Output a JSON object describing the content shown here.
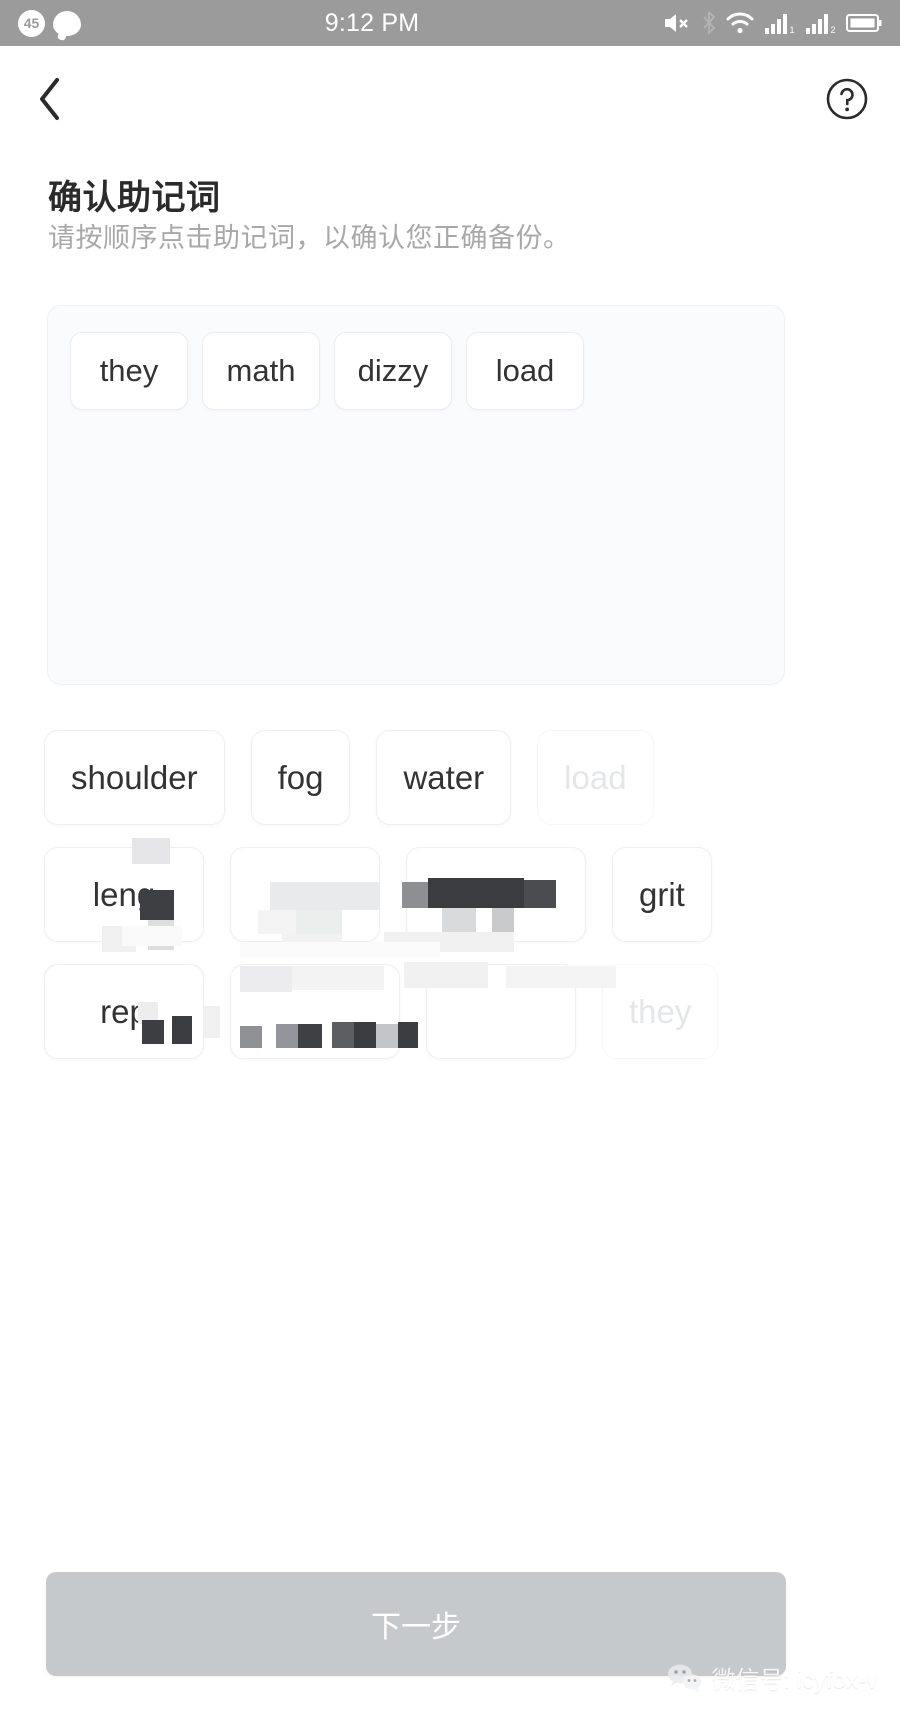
{
  "status_bar": {
    "notification_count": "45",
    "time": "9:12 PM",
    "icons": [
      "message-bubble-icon",
      "volume-mute-icon",
      "bluetooth-icon",
      "wifi-icon",
      "signal-sim1-icon",
      "signal-sim2-icon",
      "battery-icon"
    ]
  },
  "nav": {
    "back_icon": "chevron-left-icon",
    "help_icon": "help-circle-icon"
  },
  "header": {
    "title": "确认助记词",
    "subtitle": "请按顺序点击助记词，以确认您正确备份。"
  },
  "selected": {
    "words": [
      "they",
      "math",
      "dizzy",
      "load"
    ]
  },
  "word_bank": {
    "rows": [
      [
        {
          "label": "shoulder",
          "state": "available"
        },
        {
          "label": "fog",
          "state": "available"
        },
        {
          "label": "water",
          "state": "available"
        },
        {
          "label": "load",
          "state": "used"
        }
      ],
      [
        {
          "label": "leng",
          "state": "available"
        },
        {
          "label": "",
          "state": "censored"
        },
        {
          "label": "",
          "state": "censored"
        },
        {
          "label": "grit",
          "state": "available"
        }
      ],
      [
        {
          "label": "rep",
          "state": "available"
        },
        {
          "label": "",
          "state": "censored"
        },
        {
          "label": "",
          "state": "censored"
        },
        {
          "label": "they",
          "state": "used"
        }
      ]
    ]
  },
  "footer": {
    "next_label": "下一步"
  },
  "watermark": {
    "text": "微信号: icyfox-v",
    "icon": "wechat-logo-icon"
  },
  "colors": {
    "status_bar_bg": "#9b9b9b",
    "page_bg": "#ffffff",
    "panel_bg": "#fafbfc",
    "chip_border": "#ededed",
    "title": "#2b2b2b",
    "subtitle": "#a8a8a8",
    "disabled_word": "#e4e6e8",
    "button_bg": "#c6c9cb",
    "button_text": "#ffffff"
  }
}
